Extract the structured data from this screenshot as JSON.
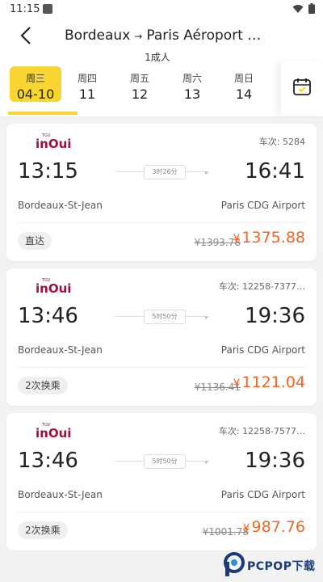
{
  "status_bar": {
    "time": "11:15",
    "wifi_icon": "wifi-icon",
    "battery_icon": "battery-icon"
  },
  "header": {
    "back_icon": "chevron-left-icon",
    "origin": "Bordeaux",
    "arrow": "→",
    "destination": "Paris Aéroport …",
    "passengers": "1成人"
  },
  "date_bar": {
    "selected_index": 0,
    "accent_color": "#f9d531",
    "tabs": [
      {
        "weekday": "周三",
        "day": "04-10"
      },
      {
        "weekday": "周四",
        "day": "11"
      },
      {
        "weekday": "周五",
        "day": "12"
      },
      {
        "weekday": "周六",
        "day": "13"
      },
      {
        "weekday": "周日",
        "day": "14"
      }
    ],
    "calendar_icon": "calendar-icon"
  },
  "trains": [
    {
      "brand": "inOui",
      "brand_small": "TGV",
      "train_no": "车次:  5284",
      "dep_time": "13:15",
      "arr_time": "16:41",
      "duration": "3时26分",
      "dep_station": "Bordeaux-St-Jean",
      "arr_station": "Paris CDG Airport",
      "tag": "直达",
      "old_price": "¥1393.78",
      "currency": "¥",
      "price": "1375.88"
    },
    {
      "brand": "inOui",
      "brand_small": "TGV",
      "train_no": "车次:  12258-7377…",
      "dep_time": "13:46",
      "arr_time": "19:36",
      "duration": "5时50分",
      "dep_station": "Bordeaux-St-Jean",
      "arr_station": "Paris CDG Airport",
      "tag": "2次换乘",
      "old_price": "¥1136.41",
      "currency": "¥",
      "price": "1121.04"
    },
    {
      "brand": "inOui",
      "brand_small": "TGV",
      "train_no": "车次:  12258-7577…",
      "dep_time": "13:46",
      "arr_time": "19:36",
      "duration": "5时50分",
      "dep_station": "Bordeaux-St-Jean",
      "arr_station": "Paris CDG Airport",
      "tag": "2次换乘",
      "old_price": "¥1001.78",
      "currency": "¥",
      "price": "987.76"
    }
  ],
  "price_color": "#f26522",
  "watermark": {
    "text": "PCPOP下载",
    "icon": "pcpop-logo-icon"
  }
}
